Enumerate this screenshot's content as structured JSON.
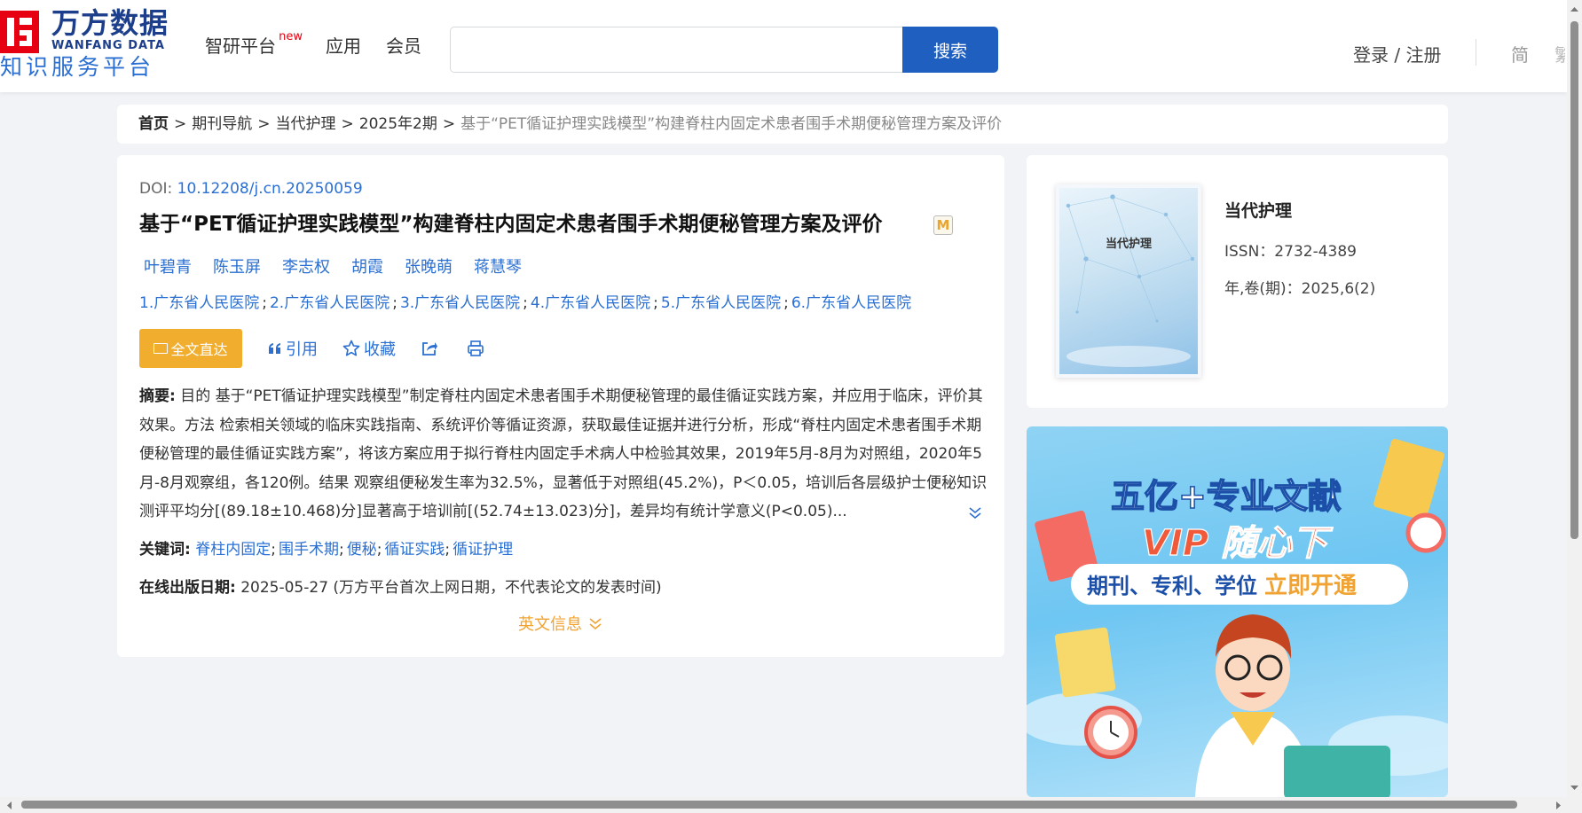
{
  "header": {
    "logo_cn": "万方数据",
    "logo_en": "WANFANG DATA",
    "logo_sub": "知识服务平台",
    "nav": [
      {
        "label": "智研平台",
        "badge": "new"
      },
      {
        "label": "应用"
      },
      {
        "label": "会员"
      }
    ],
    "search": {
      "placeholder": "",
      "value": "",
      "button_label": "搜索"
    },
    "login_label": "登录 / 注册",
    "lang_simplified": "简",
    "lang_traditional": "繁"
  },
  "breadcrumb": {
    "home": "首页",
    "items": [
      "期刊导航",
      "当代护理",
      "2025年2期"
    ],
    "current": "基于“PET循证护理实践模型”构建脊柱内固定术患者围手术期便秘管理方案及评价",
    "separator": ">"
  },
  "article": {
    "doi_label": "DOI: ",
    "doi": "10.12208/j.cn.20250059",
    "title": "基于“PET循证护理实践模型”构建脊柱内固定术患者围手术期便秘管理方案及评价",
    "m_badge": "M",
    "authors": [
      "叶碧青",
      "陈玉屏",
      "李志权",
      "胡霞",
      "张晚萌",
      "蒋慧琴"
    ],
    "affiliations": [
      "1.广东省人民医院",
      "2.广东省人民医院",
      "3.广东省人民医院",
      "4.广东省人民医院",
      "5.广东省人民医院",
      "6.广东省人民医院"
    ],
    "aff_separator": ";",
    "actions": {
      "fulltext": "全文直达",
      "cite": "引用",
      "favorite": "收藏"
    },
    "abstract_label": "摘要:",
    "abstract": "目的 基于“PET循证护理实践模型”制定脊柱内固定术患者围手术期便秘管理的最佳循证实践方案，并应用于临床，评价其效果。方法 检索相关领域的临床实践指南、系统评价等循证资源，获取最佳证据并进行分析，形成“脊柱内固定术患者围手术期便秘管理的最佳循证实践方案”，将该方案应用于拟行脊柱内固定手术病人中检验其效果，2019年5月-8月为对照组，2020年5月-8月观察组，各120例。结果 观察组便秘发生率为32.5%，显著低于对照组(45.2%)，P＜0.05，培训后各层级护士便秘知识测评平均分[(89.18±10.468)分]显著高于培训前[(52.74±13.023)分]，差异均有统计学意义(P<0.05)...",
    "keywords_label": "关键词:",
    "keywords": [
      "脊柱内固定",
      "围手术期",
      "便秘",
      "循证实践",
      "循证护理"
    ],
    "keyword_separator": ";",
    "pubdate_label": "在线出版日期:",
    "pubdate": "2025-05-27",
    "pubdate_note": "(万方平台首次上网日期，不代表论文的发表时间)",
    "english_info": "英文信息"
  },
  "journal": {
    "cover_title": "当代护理",
    "name": "当代护理",
    "issn": "ISSN：2732-4389",
    "volume": "年,卷(期)：2025,6(2)"
  },
  "banner": {
    "headline": "五亿+专业文献",
    "vip_line": "VIP 随心下",
    "sub_line": "期刊、专利、学位",
    "cta": "立即开通"
  },
  "colors": {
    "brand_blue": "#1e5fc0",
    "link_blue": "#2a6fd1",
    "brand_red": "#e60012",
    "accent_orange": "#f0ad2e",
    "page_bg": "#f1f3f7"
  }
}
